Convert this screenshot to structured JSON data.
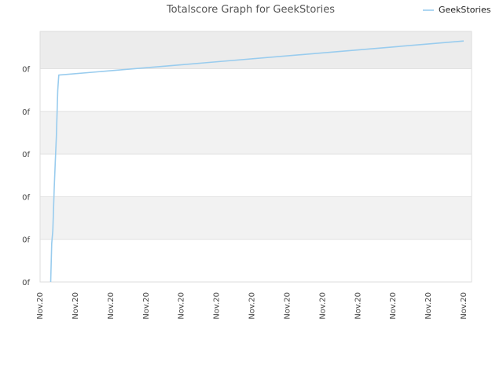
{
  "chart_data": {
    "type": "line",
    "title": "Totalscore Graph for GeekStories",
    "xlabel": "",
    "ylabel": "",
    "x_tick_labels": [
      "Nov.20",
      "Nov.20",
      "Nov.20",
      "Nov.20",
      "Nov.20",
      "Nov.20",
      "Nov.20",
      "Nov.20",
      "Nov.20",
      "Nov.20",
      "Nov.20",
      "Nov.20",
      "Nov.20"
    ],
    "y_tick_labels": [
      "0f",
      "0f",
      "0f",
      "0f",
      "0f",
      "0f"
    ],
    "xlim": [
      0,
      12
    ],
    "ylim": [
      0,
      6
    ],
    "grid": true,
    "legend_position": "top-right",
    "colors": {
      "series": "#99ccee",
      "band_alt": "#f2f2f2",
      "band_top": "#ececec"
    },
    "series": [
      {
        "name": "GeekStories",
        "x": [
          0.3,
          0.33,
          0.36,
          0.4,
          0.43,
          0.46,
          0.5,
          0.53,
          12.0
        ],
        "y": [
          0.0,
          0.9,
          1.2,
          2.2,
          2.8,
          3.4,
          4.5,
          4.85,
          5.65
        ]
      }
    ]
  }
}
